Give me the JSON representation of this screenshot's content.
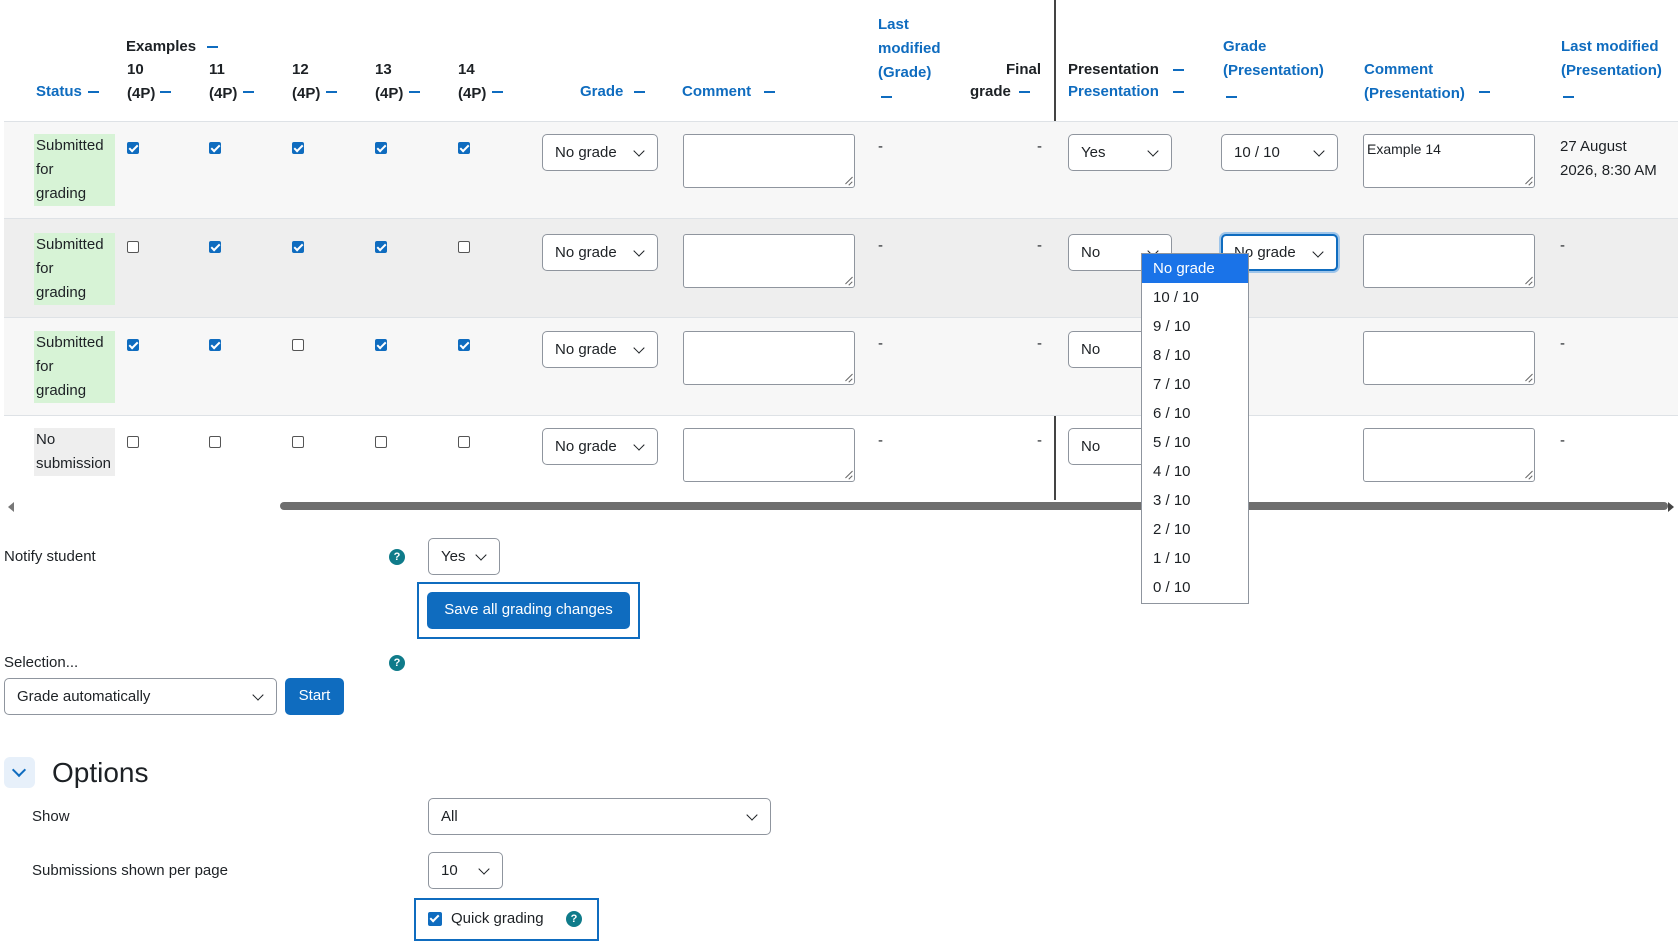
{
  "headers": {
    "status": "Status",
    "examples": "Examples",
    "ex_cols": [
      {
        "num": "10",
        "pts": "(4P)"
      },
      {
        "num": "11",
        "pts": "(4P)"
      },
      {
        "num": "12",
        "pts": "(4P)"
      },
      {
        "num": "13",
        "pts": "(4P)"
      },
      {
        "num": "14",
        "pts": "(4P)"
      }
    ],
    "grade": "Grade",
    "comment": "Comment",
    "last_modified_grade": [
      "Last",
      "modified",
      "(Grade)"
    ],
    "final_grade": [
      "Final",
      "grade"
    ],
    "presentation": "Presentation",
    "presentation_link": "Presentation",
    "grade_presentation": [
      "Grade",
      "(Presentation)"
    ],
    "comment_presentation": [
      "Comment",
      "(Presentation)"
    ],
    "last_modified_presentation": [
      "Last modified",
      "(Presentation)"
    ]
  },
  "rows": [
    {
      "status": [
        "Submitted",
        "for",
        "grading"
      ],
      "status_type": "submitted",
      "checks": [
        true,
        true,
        true,
        true,
        true
      ],
      "grade": "No grade",
      "comment": "",
      "last_modified_grade": "-",
      "final_grade": "-",
      "presentation": "Yes",
      "grade_presentation": "10 / 10",
      "comment_presentation": "Example 14",
      "last_modified_presentation": [
        "27 August",
        "2026, 8:30 AM"
      ]
    },
    {
      "status": [
        "Submitted",
        "for",
        "grading"
      ],
      "status_type": "submitted",
      "checks": [
        false,
        true,
        true,
        true,
        false
      ],
      "grade": "No grade",
      "comment": "",
      "last_modified_grade": "-",
      "final_grade": "-",
      "presentation": "No",
      "grade_presentation": "No grade",
      "comment_presentation": "",
      "last_modified_presentation": [
        "-"
      ]
    },
    {
      "status": [
        "Submitted",
        "for",
        "grading"
      ],
      "status_type": "submitted",
      "checks": [
        true,
        true,
        false,
        true,
        true
      ],
      "grade": "No grade",
      "comment": "",
      "last_modified_grade": "-",
      "final_grade": "-",
      "presentation": "No",
      "grade_presentation": "",
      "comment_presentation": "",
      "last_modified_presentation": [
        "-"
      ]
    },
    {
      "status": [
        "No",
        "submission"
      ],
      "status_type": "none",
      "checks": [
        false,
        false,
        false,
        false,
        false
      ],
      "grade": "No grade",
      "comment": "",
      "last_modified_grade": "-",
      "final_grade": "-",
      "presentation": "No",
      "grade_presentation": "",
      "comment_presentation": "",
      "last_modified_presentation": [
        "-"
      ]
    }
  ],
  "dropdown_options": [
    "No grade",
    "10 / 10",
    "9 / 10",
    "8 / 10",
    "7 / 10",
    "6 / 10",
    "5 / 10",
    "4 / 10",
    "3 / 10",
    "2 / 10",
    "1 / 10",
    "0 / 10"
  ],
  "dropdown_highlighted": "No grade",
  "notify": {
    "label": "Notify student",
    "value": "Yes"
  },
  "save_button": "Save all grading changes",
  "selection": {
    "label": "Selection...",
    "value": "Grade automatically",
    "start": "Start"
  },
  "options": {
    "title": "Options",
    "show_label": "Show",
    "show_value": "All",
    "per_page_label": "Submissions shown per page",
    "per_page_value": "10",
    "quick_grading_label": "Quick grading",
    "quick_grading_checked": true
  },
  "help_icon_glyph": "?",
  "colors": {
    "accent": "#0f6cbf",
    "submitted_bg": "#d7f3d6",
    "highlight": "#1a73e8"
  }
}
